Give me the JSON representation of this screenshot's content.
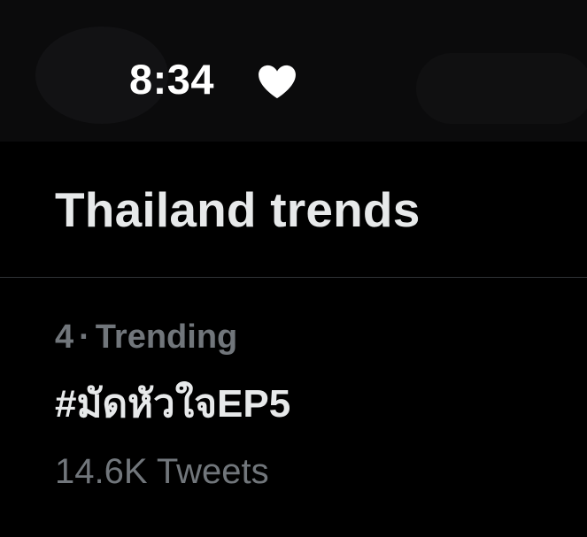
{
  "status_bar": {
    "time": "8:34",
    "icon": "heart-icon",
    "icon_color": "#ffffff"
  },
  "section": {
    "title": "Thailand trends"
  },
  "trend": {
    "rank": "4",
    "separator": "·",
    "category": "Trending",
    "name": "#มัดหัวใจEP5",
    "count": "14.6K Tweets"
  },
  "colors": {
    "background": "#000000",
    "status_bar_bg": "#0b0b0c",
    "primary_text": "#e7e9ea",
    "secondary_text": "#71767b",
    "divider": "#2f3336"
  }
}
